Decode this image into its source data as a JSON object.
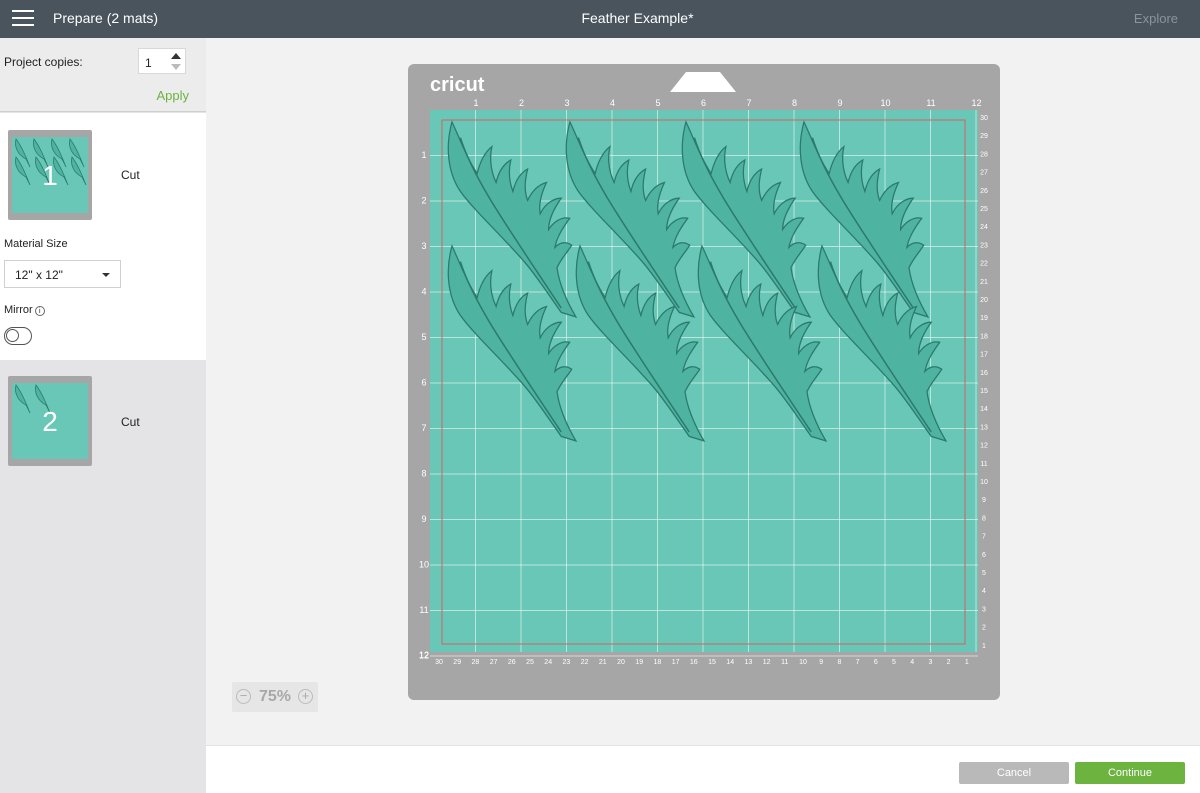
{
  "topbar": {
    "left_title": "Prepare (2 mats)",
    "center_title": "Feather Example*",
    "explore_label": "Explore"
  },
  "sidebar": {
    "project_copies_label": "Project copies:",
    "project_copies_value": "1",
    "apply_label": "Apply",
    "mats": [
      {
        "number": "1",
        "label": "Cut"
      },
      {
        "number": "2",
        "label": "Cut"
      }
    ],
    "material_size_label": "Material Size",
    "material_size_value": "12\" x 12\"",
    "mirror_label": "Mirror",
    "mirror_on": false
  },
  "mat": {
    "brand": "cricut",
    "top_ruler": [
      "1",
      "2",
      "3",
      "4",
      "5",
      "6",
      "7",
      "8",
      "9",
      "10",
      "11",
      "12"
    ],
    "left_ruler": [
      "1",
      "2",
      "3",
      "4",
      "5",
      "6",
      "7",
      "8",
      "9",
      "10",
      "11",
      "12"
    ],
    "right_ruler": [
      "30",
      "29",
      "28",
      "27",
      "26",
      "25",
      "24",
      "23",
      "22",
      "21",
      "20",
      "19",
      "18",
      "17",
      "16",
      "15",
      "14",
      "13",
      "12",
      "11",
      "10",
      "9",
      "8",
      "7",
      "6",
      "5",
      "4",
      "3",
      "2",
      "1"
    ],
    "bottom_ruler": [
      "30",
      "29",
      "28",
      "27",
      "26",
      "25",
      "24",
      "23",
      "22",
      "21",
      "20",
      "19",
      "18",
      "17",
      "16",
      "15",
      "14",
      "13",
      "12",
      "11",
      "10",
      "9",
      "8",
      "7",
      "6",
      "5",
      "4",
      "3",
      "2",
      "1"
    ],
    "corner_label": "12",
    "colors": {
      "frame": "#a6a6a6",
      "surface": "#68c7b6",
      "design": "#4fb3a1",
      "outline": "#2c7a6b"
    }
  },
  "zoom": {
    "value": "75%",
    "minus": "−",
    "plus": "+"
  },
  "footer": {
    "cancel_label": "Cancel",
    "continue_label": "Continue"
  }
}
